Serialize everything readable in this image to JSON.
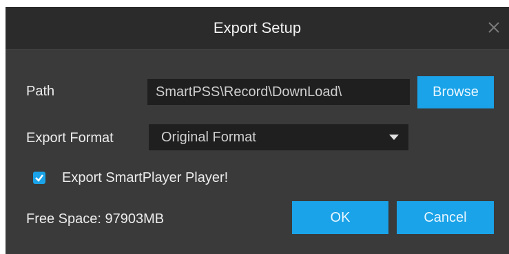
{
  "dialog": {
    "title": "Export Setup",
    "close_icon": "close-icon"
  },
  "path": {
    "label": "Path",
    "value": "SmartPSS\\Record\\DownLoad\\",
    "browse_label": "Browse"
  },
  "export_format": {
    "label": "Export Format",
    "selected": "Original Format",
    "dropdown_icon": "caret-down-icon"
  },
  "export_player": {
    "label": "Export SmartPlayer Player!",
    "checked": true
  },
  "free_space": {
    "text": "Free Space: 97903MB"
  },
  "buttons": {
    "ok": "OK",
    "cancel": "Cancel"
  },
  "colors": {
    "accent": "#1aa3e8",
    "dialog_bg": "#3a3a3a",
    "title_bg": "#2b2b2b",
    "field_bg": "#1f1f1f"
  }
}
